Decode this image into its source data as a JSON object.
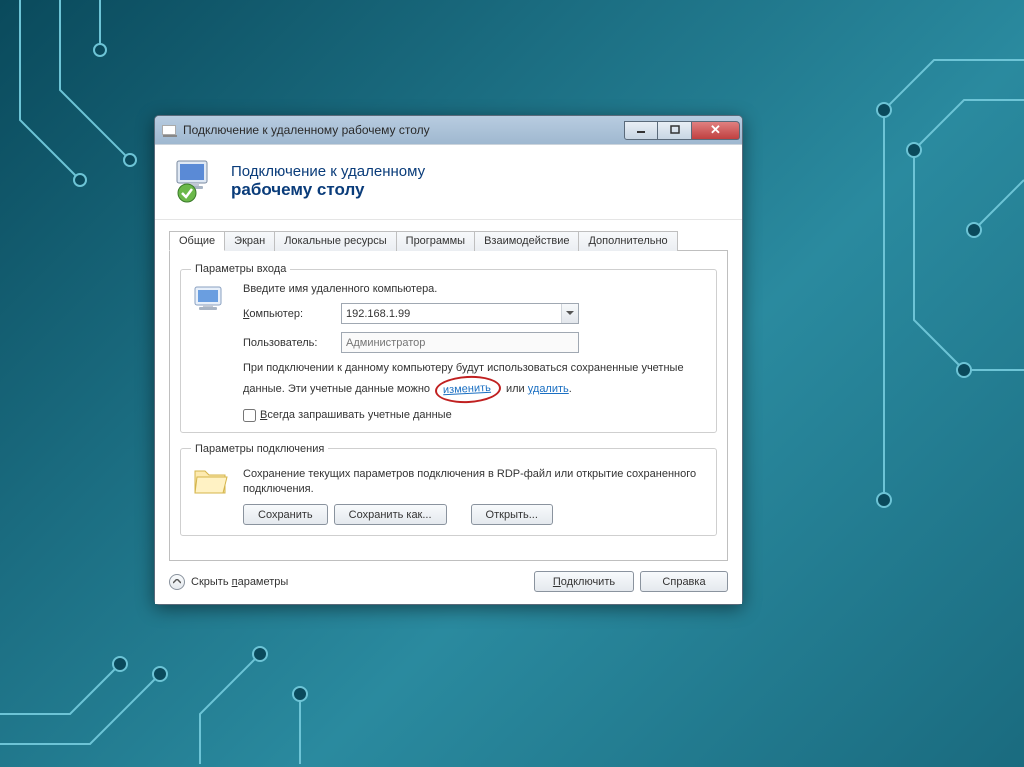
{
  "window": {
    "title": "Подключение к удаленному рабочему столу",
    "banner_line1": "Подключение к удаленному",
    "banner_line2": "рабочему столу"
  },
  "tabs": {
    "general": "Общие",
    "display": "Экран",
    "local": "Локальные ресурсы",
    "programs": "Программы",
    "experience": "Взаимодействие",
    "advanced": "Дополнительно"
  },
  "login_group": {
    "legend": "Параметры входа",
    "instruction": "Введите имя удаленного компьютера.",
    "computer_label": "Компьютер:",
    "computer_value": "192.168.1.99",
    "user_label": "Пользователь:",
    "user_placeholder": "Администратор",
    "desc_before": "При подключении к данному компьютеру будут использоваться сохраненные учетные данные. Эти учетные данные можно ",
    "link_change": "изменить",
    "desc_mid": " или ",
    "link_delete": "удалить",
    "desc_end": ".",
    "checkbox_label": "Всегда запрашивать учетные данные"
  },
  "conn_group": {
    "legend": "Параметры подключения",
    "desc": "Сохранение текущих параметров подключения в RDP-файл или открытие сохраненного подключения.",
    "btn_save": "Сохранить",
    "btn_saveas": "Сохранить как...",
    "btn_open": "Открыть..."
  },
  "footer": {
    "hide_params": "Скрыть параметры",
    "connect": "Подключить",
    "help": "Справка"
  }
}
